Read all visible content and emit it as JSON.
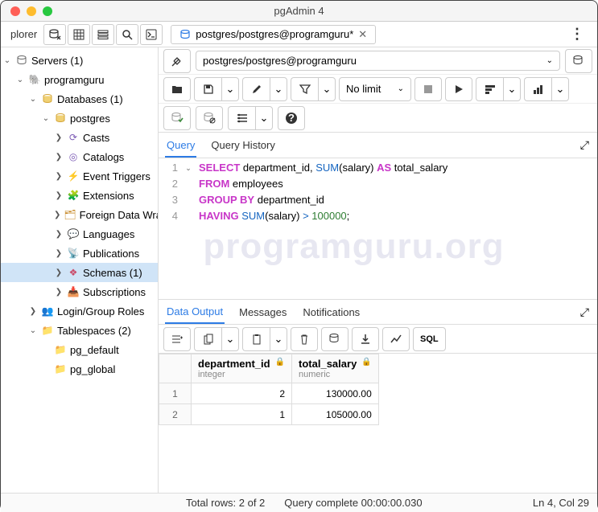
{
  "title": "pgAdmin 4",
  "sidebar_label": "plorer",
  "tab": "postgres/postgres@programguru*",
  "conn": "postgres/postgres@programguru",
  "nolimit": "No limit",
  "tree": {
    "servers": "Servers (1)",
    "server": "programguru",
    "databases": "Databases (1)",
    "db": "postgres",
    "casts": "Casts",
    "catalogs": "Catalogs",
    "eventtriggers": "Event Triggers",
    "extensions": "Extensions",
    "fdw": "Foreign Data Wrappers",
    "languages": "Languages",
    "publications": "Publications",
    "schemas": "Schemas (1)",
    "subscriptions": "Subscriptions",
    "loginroles": "Login/Group Roles",
    "tablespaces": "Tablespaces (2)",
    "pgdefault": "pg_default",
    "pgglobal": "pg_global"
  },
  "qtabs": {
    "query": "Query",
    "history": "Query History"
  },
  "sql": {
    "l1_k1": "SELECT",
    "l1_id": " department_id, ",
    "l1_fn": "SUM",
    "l1_p": "(salary) ",
    "l1_as": "AS",
    "l1_al": " total_salary",
    "l2_k": "FROM",
    "l2_t": " employees",
    "l3_k": "GROUP BY",
    "l3_c": " department_id",
    "l4_k": "HAVING ",
    "l4_fn": "SUM",
    "l4_p": "(salary) ",
    "l4_op": ">",
    "l4_sp": " ",
    "l4_n": "100000",
    "l4_e": ";"
  },
  "dtabs": {
    "data": "Data Output",
    "msg": "Messages",
    "notif": "Notifications"
  },
  "sqlbtn": "SQL",
  "cols": {
    "c1": "department_id",
    "c1t": "integer",
    "c2": "total_salary",
    "c2t": "numeric"
  },
  "rows": {
    "r1n": "1",
    "r1c1": "2",
    "r1c2": "130000.00",
    "r2n": "2",
    "r2c1": "1",
    "r2c2": "105000.00"
  },
  "status": {
    "rows": "Total rows: 2 of 2",
    "qc": "Query complete 00:00:00.030",
    "pos": "Ln 4, Col 29"
  },
  "watermark": "programguru.org"
}
